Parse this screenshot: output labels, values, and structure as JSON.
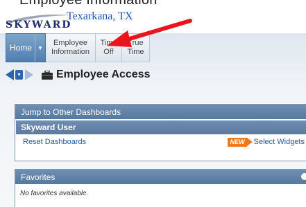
{
  "header": {
    "cut_text": "Employee Information",
    "brand": "SKYWARD",
    "location": "Texarkana, TX"
  },
  "nav": {
    "home": "Home",
    "items": [
      {
        "line1": "Employee",
        "line2": "Information"
      },
      {
        "line1": "Time",
        "line2": "Off"
      },
      {
        "line1": "True",
        "line2": "Time"
      }
    ]
  },
  "page": {
    "title": "Employee Access"
  },
  "dashboards": {
    "header": "Jump to Other Dashboards",
    "user": "Skyward User",
    "reset_link": "Reset Dashboards",
    "new_badge": "NEW",
    "select_widgets": "Select Widgets"
  },
  "favorites": {
    "header": "Favorites",
    "empty": "No favorites available."
  },
  "colors": {
    "accent_blue": "#2d63b3",
    "new_badge": "#f07a17",
    "arrow_red": "#e8161c"
  },
  "icons": {
    "back": "triangle-left-icon",
    "dropdown": "dropdown-icon",
    "forward": "triangle-right-icon",
    "briefcase": "briefcase-icon",
    "home_menu": "chevron-down-icon",
    "annotation": "red-arrow-annotation"
  }
}
